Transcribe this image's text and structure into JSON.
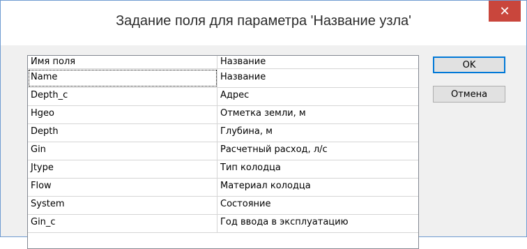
{
  "window": {
    "title": "Задание поля для параметра 'Название узла'",
    "close_symbol": "✕"
  },
  "list": {
    "headers": [
      "Имя поля",
      "Название"
    ],
    "rows": [
      {
        "field": "Name",
        "name": "Название"
      },
      {
        "field": "Depth_c",
        "name": "Адрес"
      },
      {
        "field": "Hgeo",
        "name": "Отметка земли, м"
      },
      {
        "field": "Depth",
        "name": "Глубина, м"
      },
      {
        "field": "Gin",
        "name": "Расчетный расход, л/с"
      },
      {
        "field": "Jtype",
        "name": "Тип колодца"
      },
      {
        "field": "Flow",
        "name": "Материал колодца"
      },
      {
        "field": "System",
        "name": "Состояние"
      },
      {
        "field": "Gin_c",
        "name": "Год ввода в эксплуатацию"
      }
    ]
  },
  "buttons": {
    "ok": "OK",
    "cancel": "Отмена"
  },
  "colors": {
    "close_bg": "#c9463c",
    "window_border": "#6f9bd1",
    "default_button_border": "#0078d7"
  }
}
